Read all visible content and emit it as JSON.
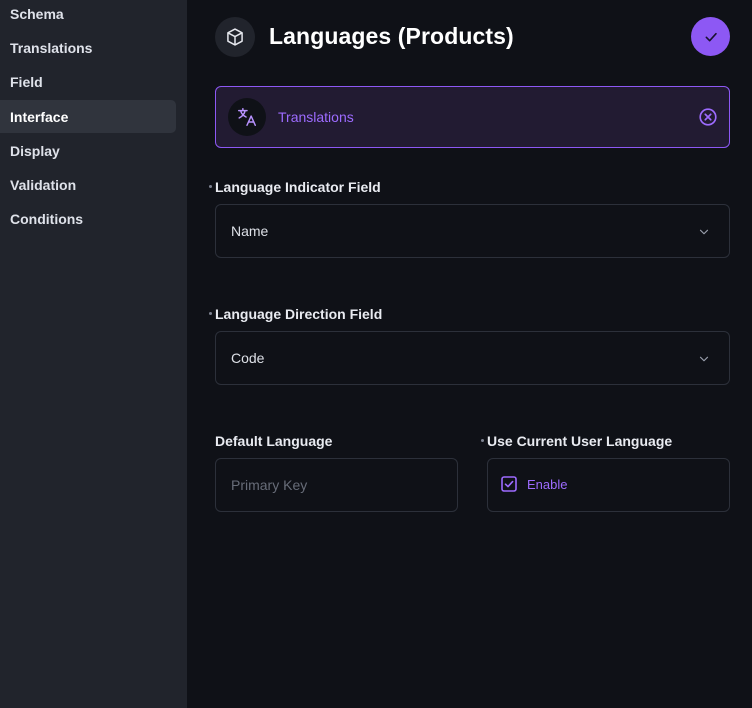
{
  "sidebar": {
    "items": [
      {
        "label": "Schema"
      },
      {
        "label": "Translations"
      },
      {
        "label": "Field"
      },
      {
        "label": "Interface"
      },
      {
        "label": "Display"
      },
      {
        "label": "Validation"
      },
      {
        "label": "Conditions"
      }
    ],
    "active_item": "Interface"
  },
  "header": {
    "title": "Languages (Products)",
    "icon": "box-icon",
    "confirm_icon": "check-icon"
  },
  "interface": {
    "label": "Translations",
    "icon": "translate-icon",
    "clear_icon": "close-circle-icon"
  },
  "fields": {
    "language_indicator": {
      "label": "Language Indicator Field",
      "value": "Name",
      "required": true
    },
    "language_direction": {
      "label": "Language Direction Field",
      "value": "Code",
      "required": true
    },
    "default_language": {
      "label": "Default Language",
      "placeholder": "Primary Key",
      "value": ""
    },
    "use_current_user_language": {
      "label": "Use Current User Language",
      "toggle_label": "Enable",
      "checked": true,
      "required": true
    }
  },
  "colors": {
    "accent": "#8d58f4",
    "background": "#0f1117",
    "sidebar": "#21242c"
  }
}
